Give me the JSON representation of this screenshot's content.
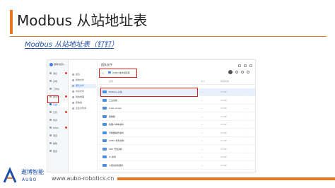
{
  "slide": {
    "title": "Modbus 从站地址表",
    "subtitle": "Modbus 从站地址表（钉钉）",
    "footer_url": "www.aubo-robotics.cn",
    "logo_cn": "遨博智能",
    "logo_en": "AUBO",
    "accent_color": "#e87722",
    "brand_color": "#1f4fa8"
  },
  "app": {
    "org_name": "遨博(北京)...",
    "nav_items": [
      {
        "label": "消息",
        "icon": "chat-icon",
        "badge": true
      },
      {
        "label": "文档",
        "icon": "doc-icon",
        "badge": false
      },
      {
        "label": "工作台",
        "icon": "workbench-icon",
        "badge": false
      },
      {
        "label": "通讯录",
        "icon": "contacts-icon",
        "badge": true
      },
      {
        "label": "云盘",
        "icon": "cloud-icon",
        "badge": false
      },
      {
        "label": "日历",
        "icon": "calendar-icon",
        "badge": true
      },
      {
        "label": "待办",
        "icon": "todo-icon",
        "badge": false
      },
      {
        "label": "DING",
        "icon": "ding-icon",
        "badge": true
      },
      {
        "label": "项目",
        "icon": "project-icon",
        "badge": false
      },
      {
        "label": "邮箱",
        "icon": "mail-icon",
        "badge": false
      },
      {
        "label": "更多",
        "icon": "more-icon",
        "badge": false
      }
    ],
    "active_nav": 4,
    "side_items": [
      {
        "label": "最近"
      },
      {
        "label": "我的文件"
      },
      {
        "label": "团队文件"
      },
      {
        "label": "共享文件"
      },
      {
        "label": "我的收藏"
      },
      {
        "label": "回收站"
      },
      {
        "label": "企业文件夹"
      }
    ],
    "active_side": 2,
    "header_title": "团队文件",
    "back_label": "<",
    "breadcrumb_current": "AUBO 技术资料库",
    "columns": [
      "名称",
      "大小",
      "修改时间"
    ],
    "rows": [
      {
        "name": "Modbus 从站",
        "size": "—",
        "time": "17:22",
        "selected": true
      },
      {
        "name": "工业总线",
        "size": "—",
        "time": "17:22",
        "selected": false
      },
      {
        "name": "aubo_scope",
        "size": "—",
        "time": "17:22",
        "selected": false
      },
      {
        "name": "控制柜",
        "size": "—",
        "time": "17:22",
        "selected": false
      },
      {
        "name": "机器人本体资料",
        "size": "—",
        "time": "17:22",
        "selected": false
      },
      {
        "name": "示教器操作资料",
        "size": "—",
        "time": "17:22",
        "selected": false
      },
      {
        "name": "AUBO 软件资料",
        "size": "—",
        "time": "17:22",
        "selected": false
      },
      {
        "name": "SDK 开发资料",
        "size": "—",
        "time": "17:22",
        "selected": false
      },
      {
        "name": "i5 资料",
        "size": "—",
        "time": "17:22",
        "selected": false
      },
      {
        "name": "小型协作机器人",
        "size": "—",
        "time": "17:22",
        "selected": false
      }
    ],
    "row_action": "···"
  }
}
